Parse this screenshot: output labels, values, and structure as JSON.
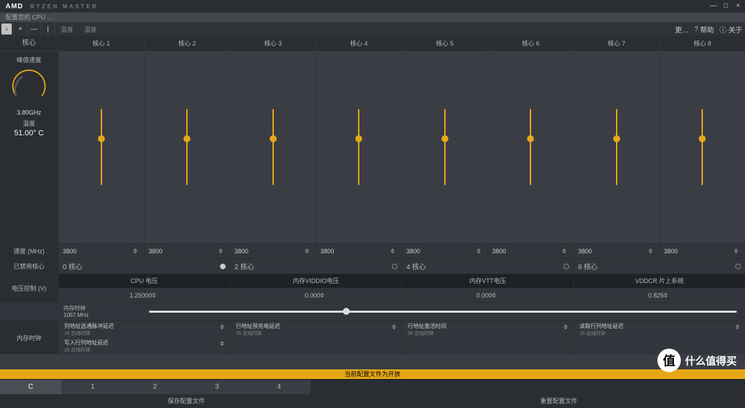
{
  "brand": {
    "vendor": "AMD",
    "product": "RYZEN MASTER"
  },
  "window": {
    "min": "—",
    "max": "□",
    "close": "×"
  },
  "profile_line": "配置您的 CPU …",
  "toolbar": {
    "arrow": "›",
    "plus": "+",
    "minus": "—",
    "pipe": "|",
    "t1": "温度",
    "t2": "温度",
    "more": "更…",
    "help_icon": "?",
    "help": "帮助",
    "about_icon": "ⓘ",
    "about": "关于"
  },
  "sidebar": {
    "cores_lbl": "核心",
    "peak_lbl": "峰值速度",
    "peak_val": "3.80GHz",
    "temp_lbl": "温度",
    "temp_val": "51.00° C",
    "speed_lbl": "速度 (MHz)",
    "disabled_lbl": "已禁用核心"
  },
  "cores": [
    {
      "name": "核心 1",
      "speed": "3800"
    },
    {
      "name": "核心 2",
      "speed": "3800"
    },
    {
      "name": "核心 3",
      "speed": "3800"
    },
    {
      "name": "核心 4",
      "speed": "3800"
    },
    {
      "name": "核心 5",
      "speed": "3800"
    },
    {
      "name": "核心 6",
      "speed": "3800"
    },
    {
      "name": "核心 7",
      "speed": "3800"
    },
    {
      "name": "核心 8",
      "speed": "3800"
    }
  ],
  "disabled_groups": [
    {
      "label": "0 核心",
      "on": true
    },
    {
      "label": "2 核心",
      "on": false
    },
    {
      "label": "4 核心",
      "on": false
    },
    {
      "label": "6 核心",
      "on": false
    }
  ],
  "voltage": {
    "section_lbl": "电压控制 (V)",
    "cols": [
      {
        "name": "CPU 电压",
        "val": "1.25000"
      },
      {
        "name": "内存VIDDIO电压",
        "val": "0.000"
      },
      {
        "name": "内存VTT电压",
        "val": "0.000"
      },
      {
        "name": "VDDCR 片上系统",
        "val": "0.825"
      }
    ]
  },
  "mem": {
    "clock_lbl": "内存时钟",
    "clock_val": "1067 MHz"
  },
  "timing": {
    "section_lbl": "内存时钟",
    "rows": [
      [
        {
          "name": "列地址选通脉冲延迟",
          "sub": "15 总线时钟"
        },
        {
          "name": "行地址预充电延迟",
          "sub": "15 总线时钟"
        },
        {
          "name": "行地址激活时间",
          "sub": "36 总线时钟"
        },
        {
          "name": "读取行列地址延迟",
          "sub": "15 总线时钟"
        }
      ],
      [
        {
          "name": "写入行列地址延迟",
          "sub": "15 总线时钟"
        },
        {
          "name": "",
          "sub": ""
        },
        {
          "name": "",
          "sub": ""
        },
        {
          "name": "",
          "sub": ""
        }
      ]
    ]
  },
  "status": "当前配置文件为开放",
  "tabs": [
    {
      "label": "C",
      "active": true
    },
    {
      "label": "1",
      "active": false
    },
    {
      "label": "2",
      "active": false
    },
    {
      "label": "3",
      "active": false
    },
    {
      "label": "4",
      "active": false
    }
  ],
  "actions": {
    "save": "保存配置文件",
    "reset": "重置配置文件"
  },
  "watermark": {
    "badge": "值",
    "text": "什么值得买"
  }
}
